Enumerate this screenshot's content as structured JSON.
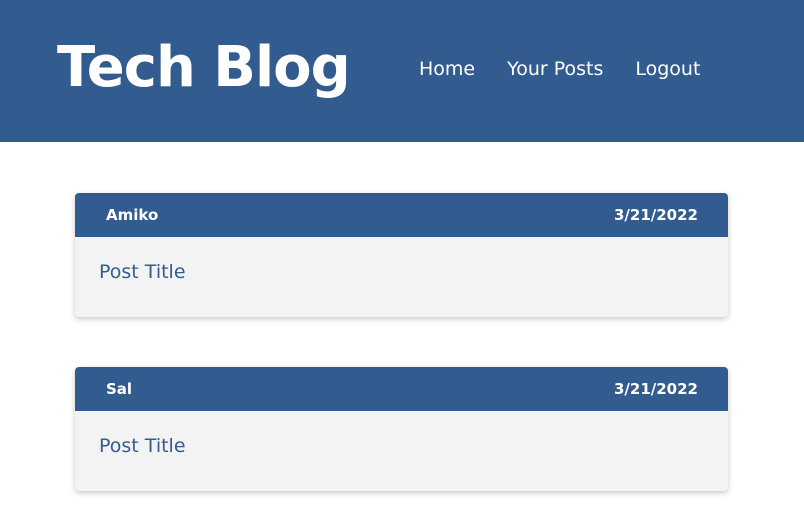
{
  "header": {
    "brand": "Tech Blog",
    "nav": [
      {
        "label": "Home"
      },
      {
        "label": "Your Posts"
      },
      {
        "label": "Logout"
      }
    ]
  },
  "posts": [
    {
      "author": "Amiko",
      "date": "3/21/2022",
      "title": "Post Title"
    },
    {
      "author": "Sal",
      "date": "3/21/2022",
      "title": "Post Title"
    }
  ],
  "colors": {
    "brand_blue": "#325c8f",
    "card_bg": "#f3f3f3",
    "page_bg": "#ffffff"
  }
}
